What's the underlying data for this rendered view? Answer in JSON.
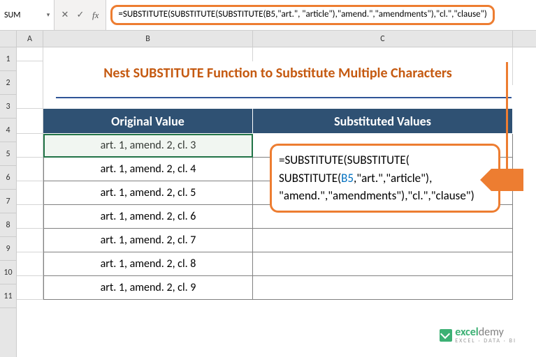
{
  "nameBox": "SUM",
  "fxLabel": "fx",
  "formulaBar": "=SUBSTITUTE(SUBSTITUTE(SUBSTITUTE(B5,\"art.\", \"article\"),\"amend.\",\"amendments\"),\"cl.\",\"clause\")",
  "columns": [
    "A",
    "B",
    "C"
  ],
  "rows": [
    "1",
    "2",
    "3",
    "4",
    "5",
    "6",
    "7",
    "8",
    "9",
    "10",
    "11"
  ],
  "title": "Nest SUBSTITUTE Function to Substitute Multiple Characters",
  "headers": {
    "b": "Original Value",
    "c": "Substituted Values"
  },
  "data": [
    "art. 1, amend. 2, cl. 3",
    "art. 1, amend. 2, cl. 4",
    "art. 1, amend. 2, cl. 5",
    "art. 1, amend. 2, cl. 6",
    "art. 1, amend. 2, cl. 7",
    "art. 1, amend. 2, cl. 8",
    "art. 1, amend. 2, cl. 9"
  ],
  "overlay": {
    "l1a": "=SUBSTITUTE(",
    "l1b": "SUBSTITUTE(",
    "l2a": "SUBSTITUTE(",
    "l2ref": "B5",
    "l2b": ",\"art.\",\"article\"),",
    "l3": "\"amend.\",\"amendments\"),\"cl.\",\"clause\")"
  },
  "watermark": {
    "brand1": "excel",
    "brand2": "demy",
    "sub": "EXCEL · DATA · BI"
  },
  "icons": {
    "cancel": "✕",
    "enter": "✓",
    "dropdown": "▾"
  }
}
